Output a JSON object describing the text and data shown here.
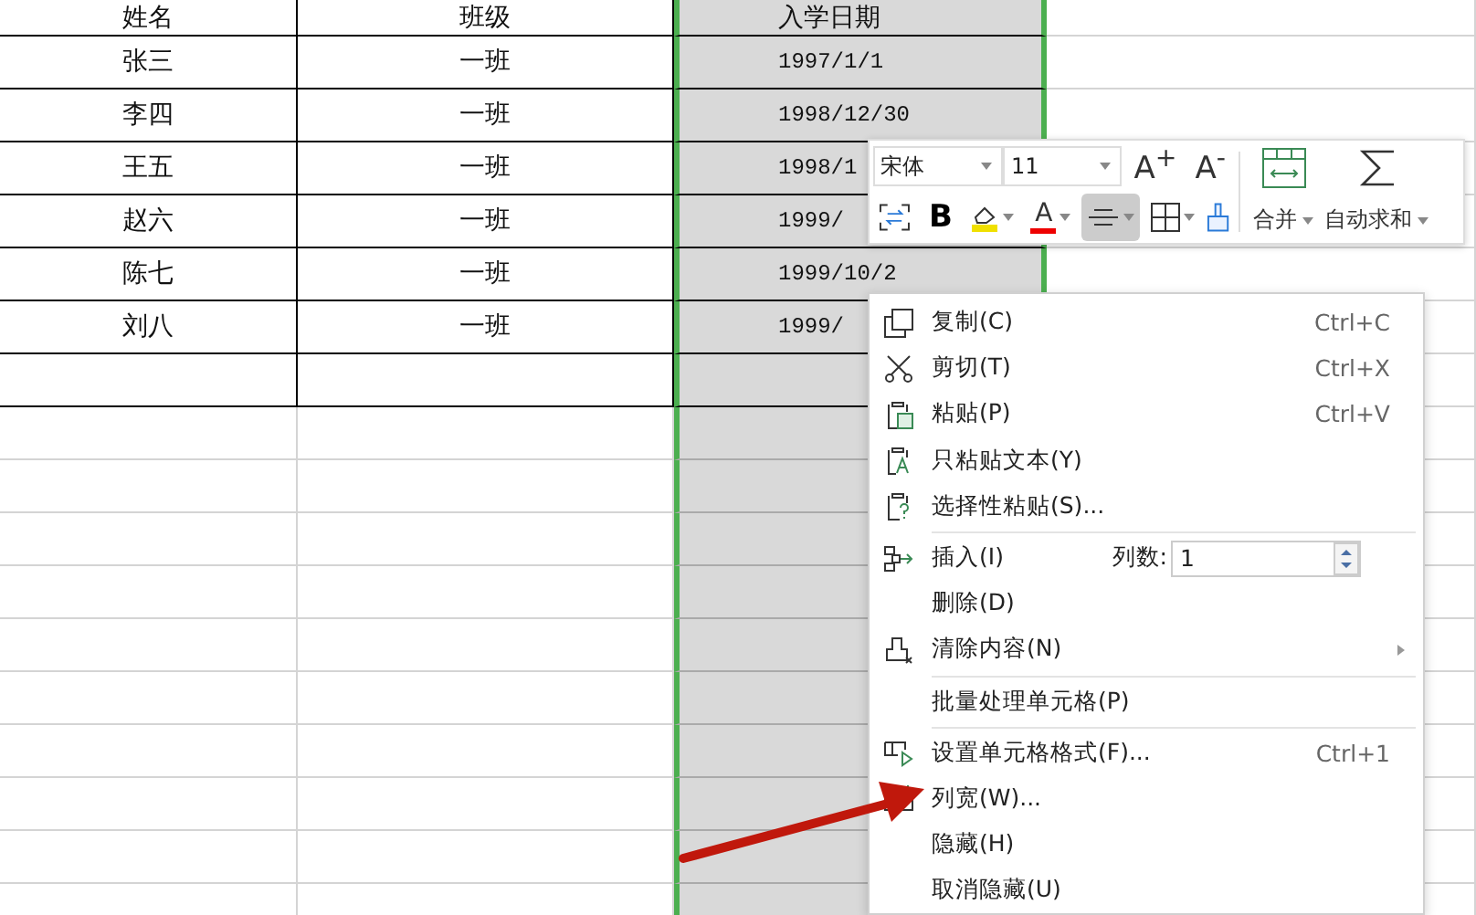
{
  "sheet": {
    "columns": [
      {
        "header": "姓名",
        "selected": false
      },
      {
        "header": "班级",
        "selected": false
      },
      {
        "header": "入学日期",
        "selected": true
      },
      {
        "selected": false
      }
    ],
    "rows": [
      {
        "cells": [
          "张三",
          "一班",
          "1997/1/1"
        ]
      },
      {
        "cells": [
          "李四",
          "一班",
          "1998/12/30"
        ]
      },
      {
        "cells": [
          "王五",
          "一班",
          "1998/1"
        ]
      },
      {
        "cells": [
          "赵六",
          "一班",
          "1999/"
        ]
      },
      {
        "cells": [
          "陈七",
          "一班",
          "1999/10/2"
        ]
      },
      {
        "cells": [
          "刘八",
          "一班",
          "1999/"
        ]
      }
    ]
  },
  "toolbar": {
    "font": "宋体",
    "size": "11",
    "grow": "A$^{+}$",
    "shrink": "A$^{-}$",
    "bold": "B",
    "font_color": "A",
    "align_center": {
      "selected": true
    },
    "merge": "合并",
    "autosum": "自动求和"
  },
  "context_menu": [
    {
      "kind": "item",
      "label": "复制(C)",
      "shortcut": "Ctrl+C"
    },
    {
      "kind": "item",
      "label": "剪切(T)",
      "shortcut": "Ctrl+X"
    },
    {
      "kind": "item",
      "label": "粘贴(P)",
      "shortcut": "Ctrl+V"
    },
    {
      "kind": "item",
      "label": "只粘贴文本(Y)"
    },
    {
      "kind": "item",
      "label": "选择性粘贴(S)..."
    },
    {
      "kind": "separator"
    },
    {
      "kind": "spinner",
      "label": "插入(I)",
      "count_label": "列数:",
      "count_value": "1"
    },
    {
      "kind": "item",
      "label": "删除(D)"
    },
    {
      "kind": "item",
      "label": "清除内容(N)",
      "submenu": true
    },
    {
      "kind": "separator"
    },
    {
      "kind": "item",
      "label": "批量处理单元格(P)"
    },
    {
      "kind": "separator"
    },
    {
      "kind": "item",
      "label": "设置单元格格式(F)...",
      "shortcut": "Ctrl+1"
    },
    {
      "kind": "item",
      "label": "列宽(W)..."
    },
    {
      "kind": "item",
      "label": "隐藏(H)"
    },
    {
      "kind": "item",
      "label": "取消隐藏(U)"
    }
  ]
}
